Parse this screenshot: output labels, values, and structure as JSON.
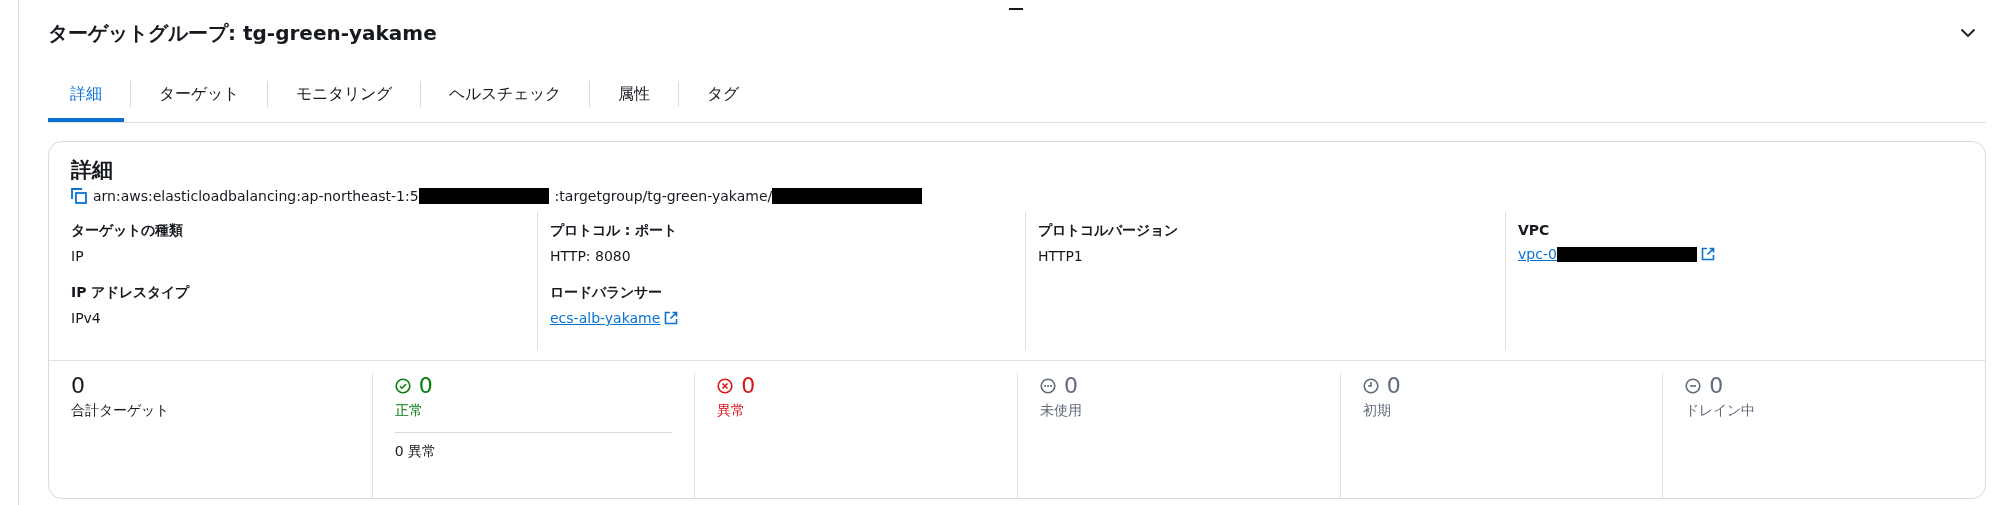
{
  "title": "ターゲットグループ: tg-green-yakame",
  "tabs": [
    {
      "label": "詳細",
      "selected": true
    },
    {
      "label": "ターゲット",
      "selected": false
    },
    {
      "label": "モニタリング",
      "selected": false
    },
    {
      "label": "ヘルスチェック",
      "selected": false
    },
    {
      "label": "属性",
      "selected": false
    },
    {
      "label": "タグ",
      "selected": false
    }
  ],
  "details": {
    "heading": "詳細",
    "arn_parts": [
      "arn:aws:elasticloadbalancing:ap-northeast-1:5",
      ":targetgroup/tg-green-yakame/"
    ],
    "columns": [
      [
        {
          "label": "ターゲットの種類",
          "value": "IP"
        },
        {
          "label": "IP アドレスタイプ",
          "value": "IPv4"
        }
      ],
      [
        {
          "label": "プロトコル : ポート",
          "value": "HTTP: 8080"
        },
        {
          "label": "ロードバランサー",
          "link": "ecs-alb-yakame"
        }
      ],
      [
        {
          "label": "プロトコルバージョン",
          "value": "HTTP1"
        }
      ],
      [
        {
          "label": "VPC",
          "link": "vpc-0",
          "redacted": true
        }
      ]
    ]
  },
  "stats": [
    {
      "kind": "total",
      "count": "0",
      "label": "合計ターゲット"
    },
    {
      "kind": "healthy",
      "count": "0",
      "label": "正常",
      "sub": "0 異常"
    },
    {
      "kind": "unhealthy",
      "count": "0",
      "label": "異常"
    },
    {
      "kind": "unused",
      "count": "0",
      "label": "未使用"
    },
    {
      "kind": "initial",
      "count": "0",
      "label": "初期"
    },
    {
      "kind": "draining",
      "count": "0",
      "label": "ドレイン中"
    }
  ]
}
